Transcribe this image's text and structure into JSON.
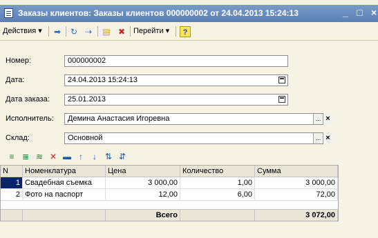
{
  "window": {
    "title": "Заказы клиентов: Заказы клиентов 000000002 от 24.04.2013 15:24:13",
    "minimize": "_",
    "maximize": "□",
    "close": "×"
  },
  "toolbar": {
    "actions_label": "Действия ▾",
    "goto_label": "Перейти ▾",
    "help_label": "?"
  },
  "form": {
    "number_label": "Номер:",
    "number_value": "000000002",
    "date_label": "Дата:",
    "date_value": "24.04.2013 15:24:13",
    "order_date_label": "Дата заказа:",
    "order_date_value": "25.01.2013",
    "executor_label": "Исполнитель:",
    "executor_value": "Демина Анастасия Игоревна",
    "warehouse_label": "Склад:",
    "warehouse_value": "Основной",
    "select_button": "...",
    "clear_button": "×"
  },
  "table": {
    "columns": [
      "N",
      "Номенклатура",
      "Цена",
      "Количество",
      "Сумма"
    ],
    "rows": [
      {
        "n": "1",
        "item": "Свадебная съемка",
        "price": "3 000,00",
        "qty": "1,00",
        "sum": "3 000,00"
      },
      {
        "n": "2",
        "item": "Фото на паспорт",
        "price": "12,00",
        "qty": "6,00",
        "sum": "72,00"
      }
    ],
    "footer_label": "Всего",
    "footer_total": "3 072,00"
  },
  "colors": {
    "titlebar": "#6a8dc1",
    "window_bg": "#f7f3e4",
    "selection": "#0a246a"
  }
}
